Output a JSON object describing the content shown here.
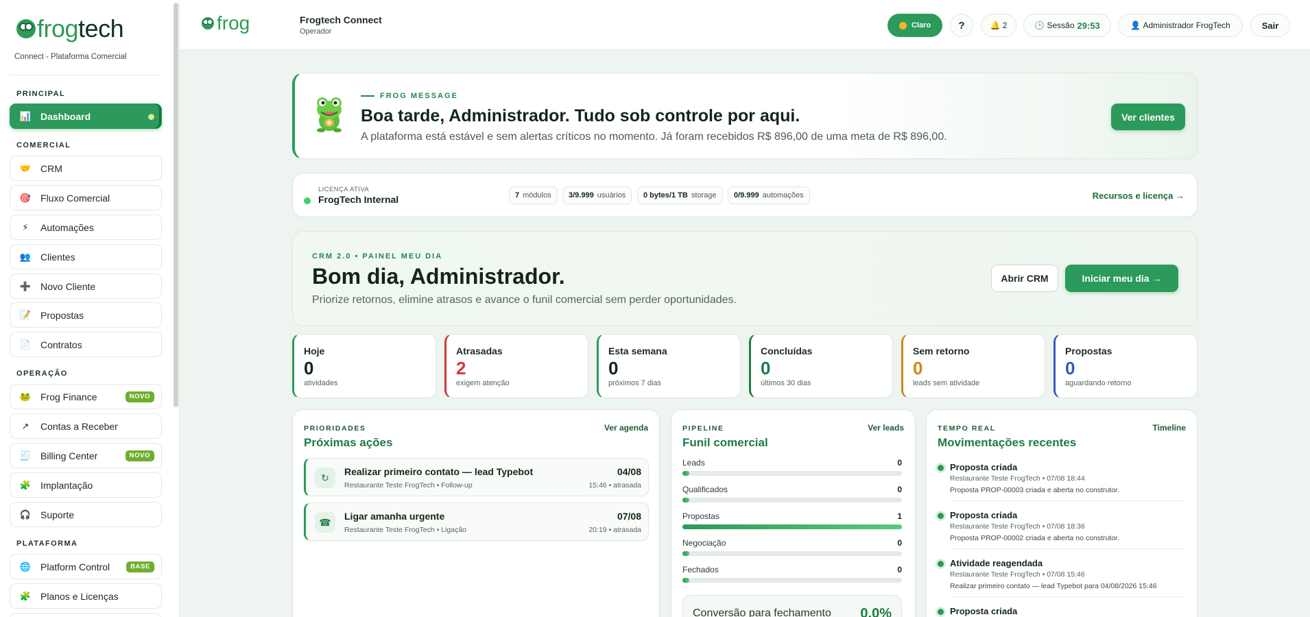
{
  "brand": {
    "logo_green": "frog",
    "logo_dark": "tech",
    "subtitle": "Connect - Plataforma Comercial"
  },
  "sidebar": {
    "sections": [
      "PRINCIPAL",
      "COMERCIAL",
      "OPERAÇÃO",
      "PLATAFORMA"
    ],
    "items": [
      {
        "label": "Dashboard",
        "icon": "chart-icon",
        "glyph": "📊",
        "active": true
      },
      {
        "label": "CRM",
        "icon": "handshake-icon",
        "glyph": "🤝"
      },
      {
        "label": "Fluxo Comercial",
        "icon": "target-icon",
        "glyph": "🎯"
      },
      {
        "label": "Automações",
        "icon": "lightning-icon",
        "glyph": "⚡"
      },
      {
        "label": "Clientes",
        "icon": "people-icon",
        "glyph": "👥"
      },
      {
        "label": "Novo Cliente",
        "icon": "plus-icon",
        "glyph": "➕"
      },
      {
        "label": "Propostas",
        "icon": "memo-icon",
        "glyph": "📝"
      },
      {
        "label": "Contratos",
        "icon": "document-icon",
        "glyph": "📄"
      },
      {
        "label": "Frog Finance",
        "icon": "frog-icon",
        "glyph": "🐸",
        "badge": "NOVO"
      },
      {
        "label": "Contas a Receber",
        "icon": "arrow-icon",
        "glyph": "↗"
      },
      {
        "label": "Billing Center",
        "icon": "receipt-icon",
        "glyph": "🧾",
        "badge": "NOVO"
      },
      {
        "label": "Implantação",
        "icon": "puzzle-icon",
        "glyph": "🧩"
      },
      {
        "label": "Suporte",
        "icon": "headset-icon",
        "glyph": "🎧"
      },
      {
        "label": "Platform Control",
        "icon": "globe-icon",
        "glyph": "🌐",
        "badge": "BASE"
      },
      {
        "label": "Planos e Licenças",
        "icon": "puzzle-icon",
        "glyph": "🧩"
      }
    ]
  },
  "header": {
    "logo": "frog",
    "app_title": "Frogtech Connect",
    "app_role": "Operador",
    "theme_label": "Claro",
    "help_label": "?",
    "notif_glyph": "🔔",
    "notif_count": "2",
    "session_glyph": "🕒",
    "session_label": "Sessão",
    "session_time": "29:53",
    "user_glyph": "👤",
    "user_name": "Administrador FrogTech",
    "logout_label": "Sair"
  },
  "hero": {
    "eyebrow": "FROG MESSAGE",
    "title": "Boa tarde, Administrador. Tudo sob controle por aqui.",
    "text": "A plataforma está estável e sem alertas críticos no momento. Já foram recebidos R$ 896,00 de uma meta de R$ 896,00.",
    "button": "Ver clientes"
  },
  "license": {
    "label": "LICENÇA ATIVA",
    "name": "FrogTech Internal",
    "chips": [
      {
        "value": "7",
        "unit": "módulos"
      },
      {
        "value": "3/9.999",
        "unit": "usuários"
      },
      {
        "value": "0 bytes/1 TB",
        "unit": "storage"
      },
      {
        "value": "0/9.999",
        "unit": "automações"
      }
    ],
    "link": "Recursos e licença  →"
  },
  "crm": {
    "eyebrow": "CRM 2.0 • PAINEL MEU DIA",
    "title": "Bom dia, Administrador.",
    "text": "Priorize retornos, elimine atrasos e avance o funil comercial sem perder oportunidades.",
    "btn_secondary": "Abrir CRM",
    "btn_primary": "Iniciar meu dia →"
  },
  "stats": [
    {
      "label": "Hoje",
      "value": "0",
      "sub": "atividades",
      "color": "#2b9a5a"
    },
    {
      "label": "Atrasadas",
      "value": "2",
      "sub": "exigem atenção",
      "color": "#d0383d"
    },
    {
      "label": "Esta semana",
      "value": "0",
      "sub": "próximos 7 dias",
      "color": "#2b9a5a"
    },
    {
      "label": "Concluídas",
      "value": "0",
      "sub": "últimos 30 dias",
      "color": "#1f7a44"
    },
    {
      "label": "Sem retorno",
      "value": "0",
      "sub": "leads sem atividade",
      "color": "#c98a14"
    },
    {
      "label": "Propostas",
      "value": "0",
      "sub": "aguardando retorno",
      "color": "#3558c7"
    }
  ],
  "priorities": {
    "eyebrow": "PRIORIDADES",
    "title": "Próximas ações",
    "link": "Ver agenda",
    "tasks": [
      {
        "icon": "refresh-icon",
        "glyph": "↻",
        "title": "Realizar primeiro contato — lead Typebot",
        "sub": "Restaurante Teste FrogTech • Follow-up",
        "date": "04/08",
        "when": "15:46 • atrasada"
      },
      {
        "icon": "phone-icon",
        "glyph": "☎",
        "title": "Ligar amanha urgente",
        "sub": "Restaurante Teste FrogTech • Ligação",
        "date": "07/08",
        "when": "20:19 • atrasada"
      }
    ]
  },
  "pipeline": {
    "eyebrow": "PIPELINE",
    "title": "Funil comercial",
    "link": "Ver leads",
    "stages": [
      {
        "name": "Leads",
        "count": 0,
        "fill": 0.03
      },
      {
        "name": "Qualificados",
        "count": 0,
        "fill": 0.03
      },
      {
        "name": "Propostas",
        "count": 1,
        "fill": 1.0
      },
      {
        "name": "Negociação",
        "count": 0,
        "fill": 0.03
      },
      {
        "name": "Fechados",
        "count": 0,
        "fill": 0.03
      }
    ],
    "conversion_label": "Conversão para fechamento",
    "conversion_value": "0.0%"
  },
  "realtime": {
    "eyebrow": "TEMPO REAL",
    "title": "Movimentações recentes",
    "link": "Timeline",
    "events": [
      {
        "title": "Proposta criada",
        "meta": "Restaurante Teste FrogTech • 07/08 18:44",
        "desc": "Proposta PROP-00003 criada e aberta no construtor."
      },
      {
        "title": "Proposta criada",
        "meta": "Restaurante Teste FrogTech • 07/08 18:36",
        "desc": "Proposta PROP-00002 criada e aberta no construtor."
      },
      {
        "title": "Atividade reagendada",
        "meta": "Restaurante Teste FrogTech • 07/08 15:46",
        "desc": "Realizar primeiro contato — lead Typebot para 04/08/2026 15:46"
      },
      {
        "title": "Proposta criada",
        "meta": "",
        "desc": ""
      }
    ]
  }
}
